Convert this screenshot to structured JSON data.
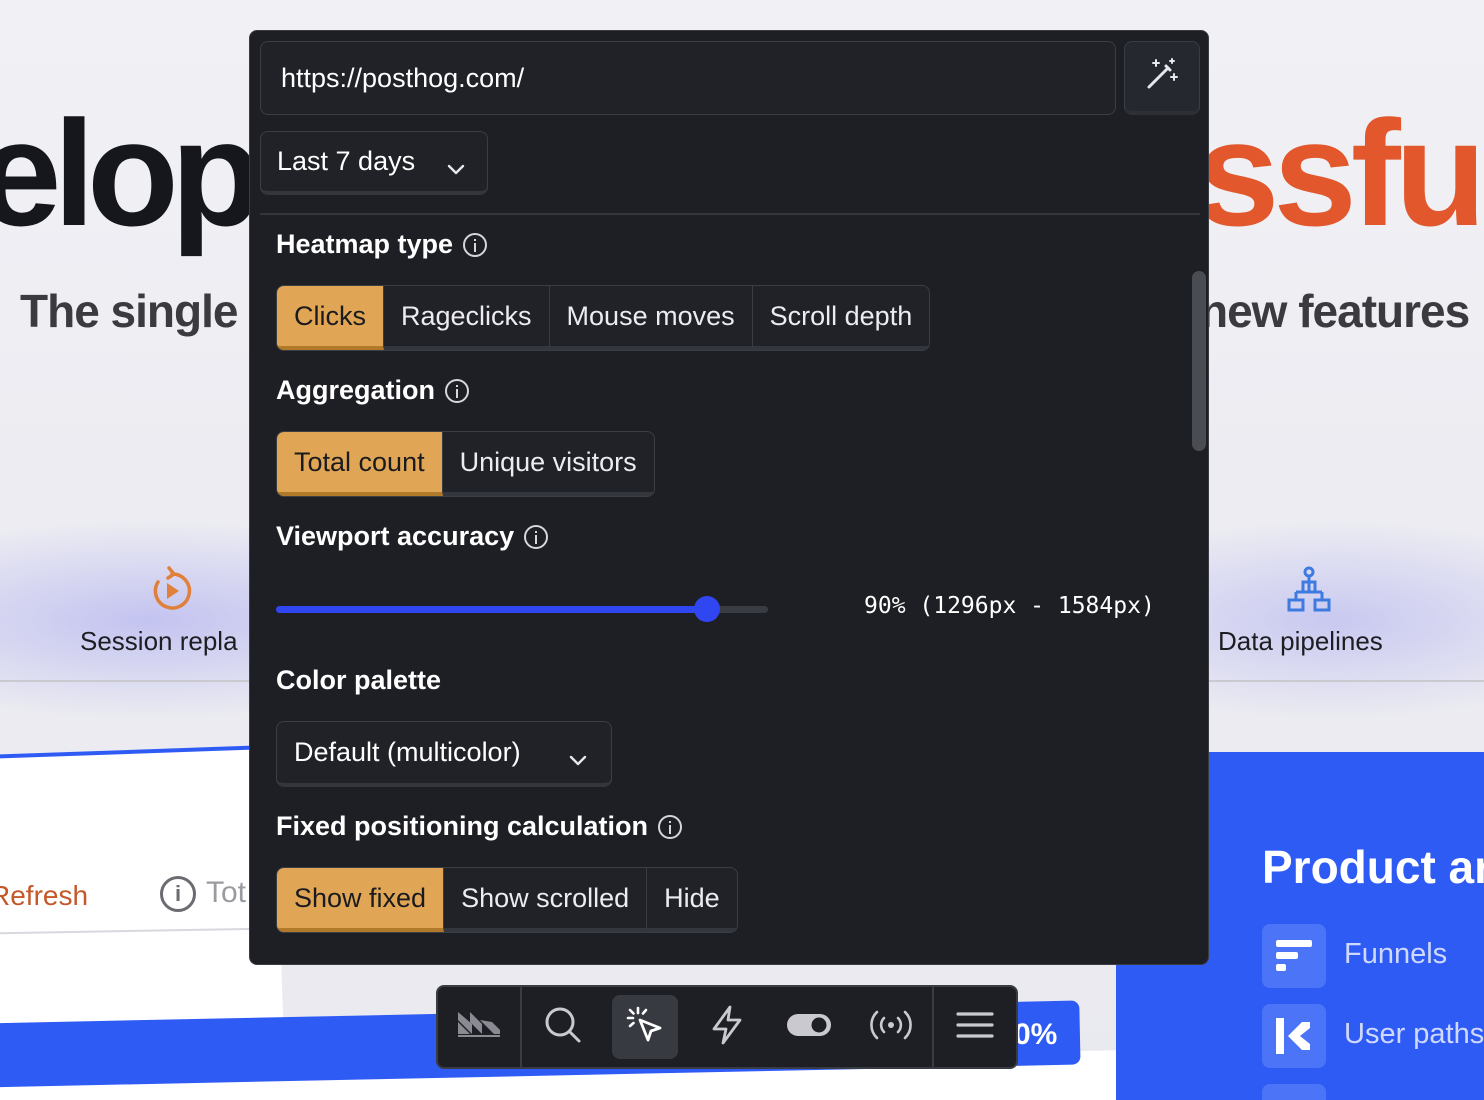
{
  "background": {
    "hero_left": "elop",
    "hero_right": "ssful",
    "subtitle_left": "The single",
    "subtitle_right": "new features",
    "feature_left_label": "Session repla",
    "feature_right_label": "Data pipelines",
    "refresh_label": "Refresh",
    "tot_label": "Tot",
    "progress_text": "0%",
    "product_title": "Product ar",
    "product_items": [
      {
        "label": "Funnels",
        "icon": "funnel-icon"
      },
      {
        "label": "User paths",
        "icon": "user-paths-icon"
      }
    ]
  },
  "heatmap": {
    "url_value": "https://posthog.com/",
    "date_range": "Last 7 days",
    "heatmap_type": {
      "title": "Heatmap type",
      "options": [
        "Clicks",
        "Rageclicks",
        "Mouse moves",
        "Scroll depth"
      ],
      "selected": "Clicks"
    },
    "aggregation": {
      "title": "Aggregation",
      "options": [
        "Total count",
        "Unique visitors"
      ],
      "selected": "Total count"
    },
    "viewport": {
      "title": "Viewport accuracy",
      "value_fraction": 0.875,
      "value_text": "90% (1296px - 1584px)"
    },
    "palette": {
      "title": "Color palette",
      "selected": "Default (multicolor)"
    },
    "fixed_positioning": {
      "title": "Fixed positioning calculation",
      "options": [
        "Show fixed",
        "Show scrolled",
        "Hide"
      ],
      "selected": "Show fixed"
    }
  },
  "toolbar": {
    "items": [
      "posthog-logo-icon",
      "search-icon",
      "heatmap-cursor-icon",
      "actions-bolt-icon",
      "feature-flags-toggle-icon",
      "broadcast-icon",
      "menu-icon"
    ],
    "active": "heatmap-cursor-icon"
  },
  "colors": {
    "accent": "#e0a655",
    "slider": "#2f46f0",
    "panel_bg": "#1e1f24",
    "brand_orange": "#e2572b",
    "brand_blue": "#2f5bf5"
  }
}
